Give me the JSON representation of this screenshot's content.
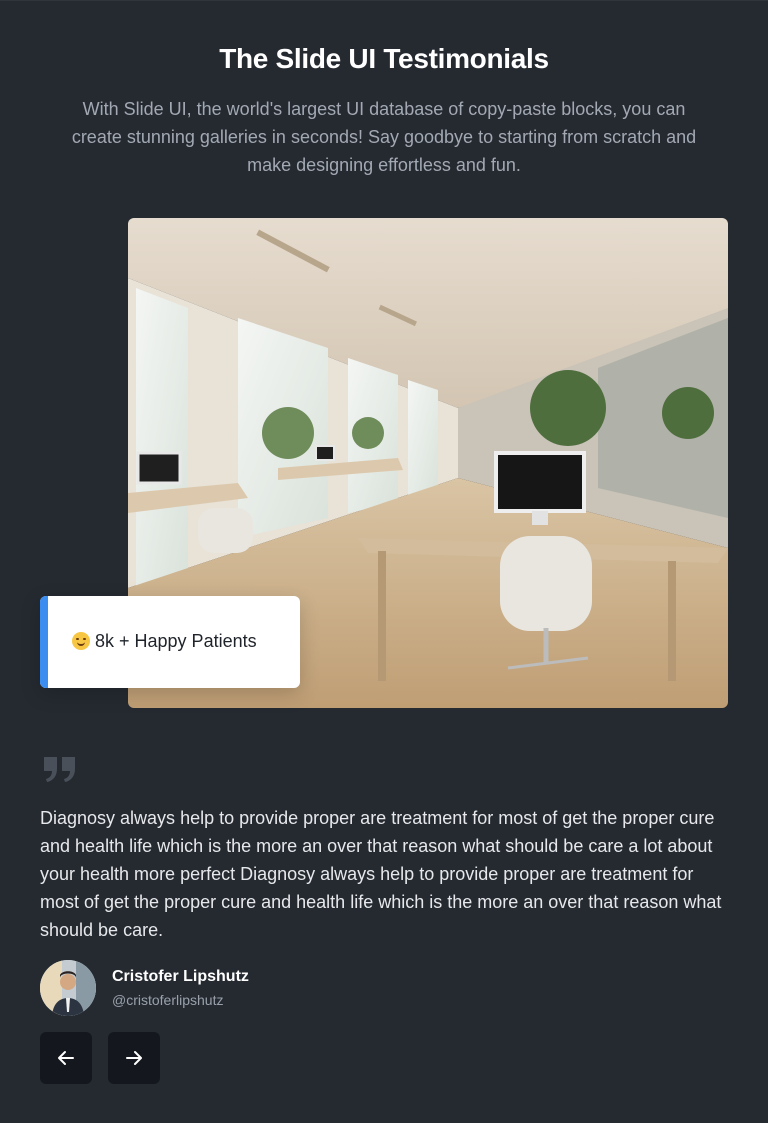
{
  "header": {
    "title": "The Slide UI Testimonials",
    "subtitle": "With Slide UI, the world's largest UI database of copy-paste blocks, you can create stunning galleries in seconds! Say goodbye to starting from scratch and make designing effortless and fun."
  },
  "badge": {
    "icon": "smiling-face-icon",
    "text": "8k + Happy Patients"
  },
  "testimonial": {
    "quote": "Diagnosy always help to provide proper are treatment for most of get the proper cure and health life which is the more an over that reason what should be care a lot about your health more perfect Diagnosy always help to provide proper are treatment for most of get the proper cure and health life which is the more an over that reason what should be care.",
    "author_name": "Cristofer Lipshutz",
    "author_handle": "@cristoferlipshutz"
  },
  "navigation": {
    "prev_icon": "arrow-left-icon",
    "next_icon": "arrow-right-icon"
  },
  "colors": {
    "background": "#252a31",
    "accent": "#3b8ef0",
    "button": "#14181e"
  }
}
